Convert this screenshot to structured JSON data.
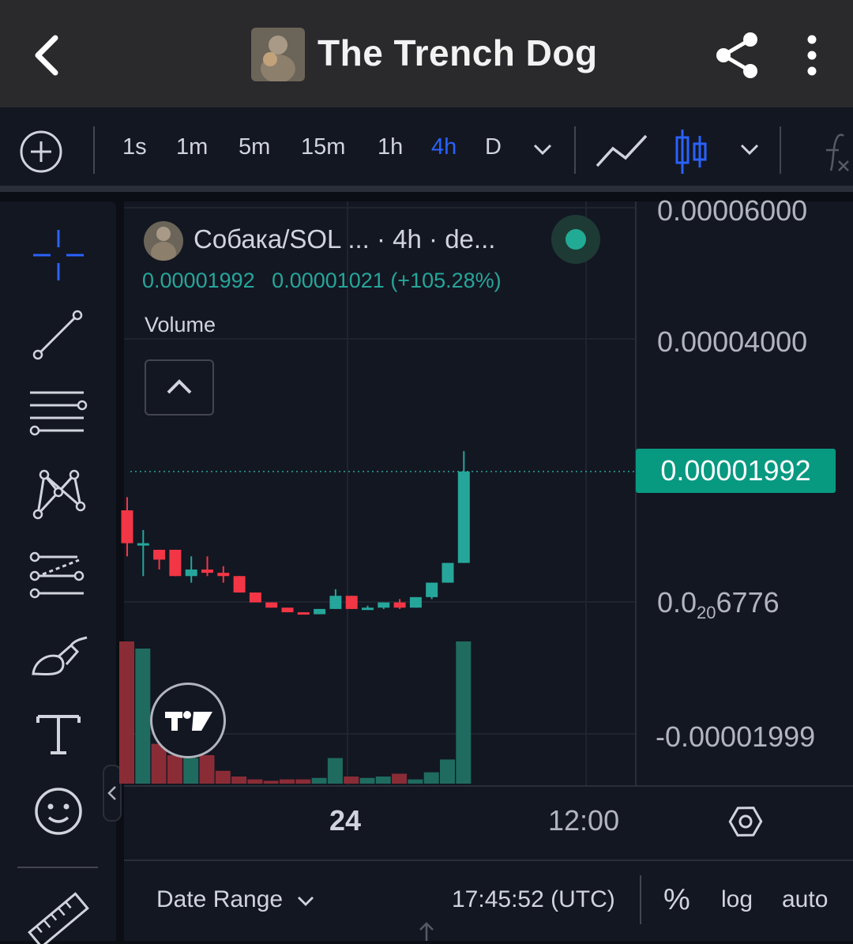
{
  "header": {
    "title": "The Trench Dog",
    "icons": {
      "back": "chevron-left-icon",
      "share": "share-icon",
      "more": "more-vertical-icon"
    }
  },
  "toolbar": {
    "timeframes": [
      "1s",
      "1m",
      "5m",
      "15m",
      "1h",
      "4h",
      "D"
    ],
    "active_timeframe": "4h",
    "icons": {
      "add": "plus-circle-icon",
      "line": "line-chart-icon",
      "candle": "candlestick-icon",
      "fx": "indicators-fx-icon"
    }
  },
  "tools": [
    "crosshair-icon",
    "trend-line-icon",
    "fib-retracement-icon",
    "pattern-icon",
    "prediction-icon",
    "brush-icon",
    "text-icon",
    "emoji-icon",
    "ruler-icon"
  ],
  "legend": {
    "title": "Собака/SOL ...  · 4h · de...",
    "price": "0.00001992",
    "change": "0.00001021 (+105.28%)",
    "volume_label": "Volume"
  },
  "price_axis": {
    "labels": [
      "0.00006000",
      "0.00004000",
      "-0.00001999"
    ],
    "subscript_label": {
      "prefix": "0.0",
      "sub": "20",
      "suffix": "6776"
    },
    "current_price": "0.00001992"
  },
  "time_axis": {
    "labels": [
      "24",
      "12:00"
    ]
  },
  "bottom": {
    "date_range": "Date Range",
    "time": "17:45:52 (UTC)",
    "percent": "%",
    "log": "log",
    "auto": "auto"
  },
  "colors": {
    "up": "#26a69a",
    "down": "#f23645",
    "accent": "#2962ff"
  },
  "chart_data": {
    "type": "candlestick",
    "candles": [
      {
        "o": 1.4e-05,
        "h": 1.6e-05,
        "l": 7e-06,
        "c": 9e-06
      },
      {
        "o": 9e-06,
        "h": 1.1e-05,
        "l": 4e-06,
        "c": 9e-06
      },
      {
        "o": 8e-06,
        "h": 8e-06,
        "l": 5e-06,
        "c": 6.5e-06
      },
      {
        "o": 8e-06,
        "h": 8e-06,
        "l": 4e-06,
        "c": 4e-06
      },
      {
        "o": 4e-06,
        "h": 7e-06,
        "l": 3e-06,
        "c": 5e-06
      },
      {
        "o": 5e-06,
        "h": 7e-06,
        "l": 4e-06,
        "c": 4.5e-06
      },
      {
        "o": 4.5e-06,
        "h": 5.5e-06,
        "l": 3e-06,
        "c": 4e-06
      },
      {
        "o": 4e-06,
        "h": 4e-06,
        "l": 1.5e-06,
        "c": 1.5e-06
      },
      {
        "o": 1.5e-06,
        "h": 1.5e-06,
        "l": 0.0,
        "c": 0.0
      },
      {
        "o": 0.0,
        "h": 0.0,
        "l": -8e-07,
        "c": -8e-07
      },
      {
        "o": -8e-07,
        "h": -8e-07,
        "l": -1.5e-06,
        "c": -1.5e-06
      },
      {
        "o": -1.5e-06,
        "h": -1.5e-06,
        "l": -1.8e-06,
        "c": -1.8e-06
      },
      {
        "o": -1.8e-06,
        "h": -1e-06,
        "l": -1.8e-06,
        "c": -1e-06
      },
      {
        "o": -1e-06,
        "h": 2e-06,
        "l": -1e-06,
        "c": 1e-06
      },
      {
        "o": 1e-06,
        "h": 1e-06,
        "l": -1e-06,
        "c": -1e-06
      },
      {
        "o": -1e-06,
        "h": -5e-07,
        "l": -1e-06,
        "c": -8e-07
      },
      {
        "o": -8e-07,
        "h": 0.0,
        "l": -1e-06,
        "c": 0.0
      },
      {
        "o": 0.0,
        "h": 5e-07,
        "l": -1e-06,
        "c": -8e-07
      },
      {
        "o": -8e-07,
        "h": 8e-07,
        "l": -8e-07,
        "c": 8e-07
      },
      {
        "o": 8e-07,
        "h": 3e-06,
        "l": 5e-07,
        "c": 3e-06
      },
      {
        "o": 3e-06,
        "h": 6e-06,
        "l": 3e-06,
        "c": 6e-06
      },
      {
        "o": 6e-06,
        "h": 2.3e-05,
        "l": 6e-06,
        "c": 1.99e-05
      }
    ],
    "volumes": [
      100,
      95,
      28,
      20,
      18,
      20,
      9,
      5,
      3,
      2,
      3,
      3,
      4,
      18,
      5,
      4,
      5,
      7,
      3,
      8,
      17,
      100
    ],
    "ylim": [
      -1.999e-05,
      6e-05
    ]
  }
}
